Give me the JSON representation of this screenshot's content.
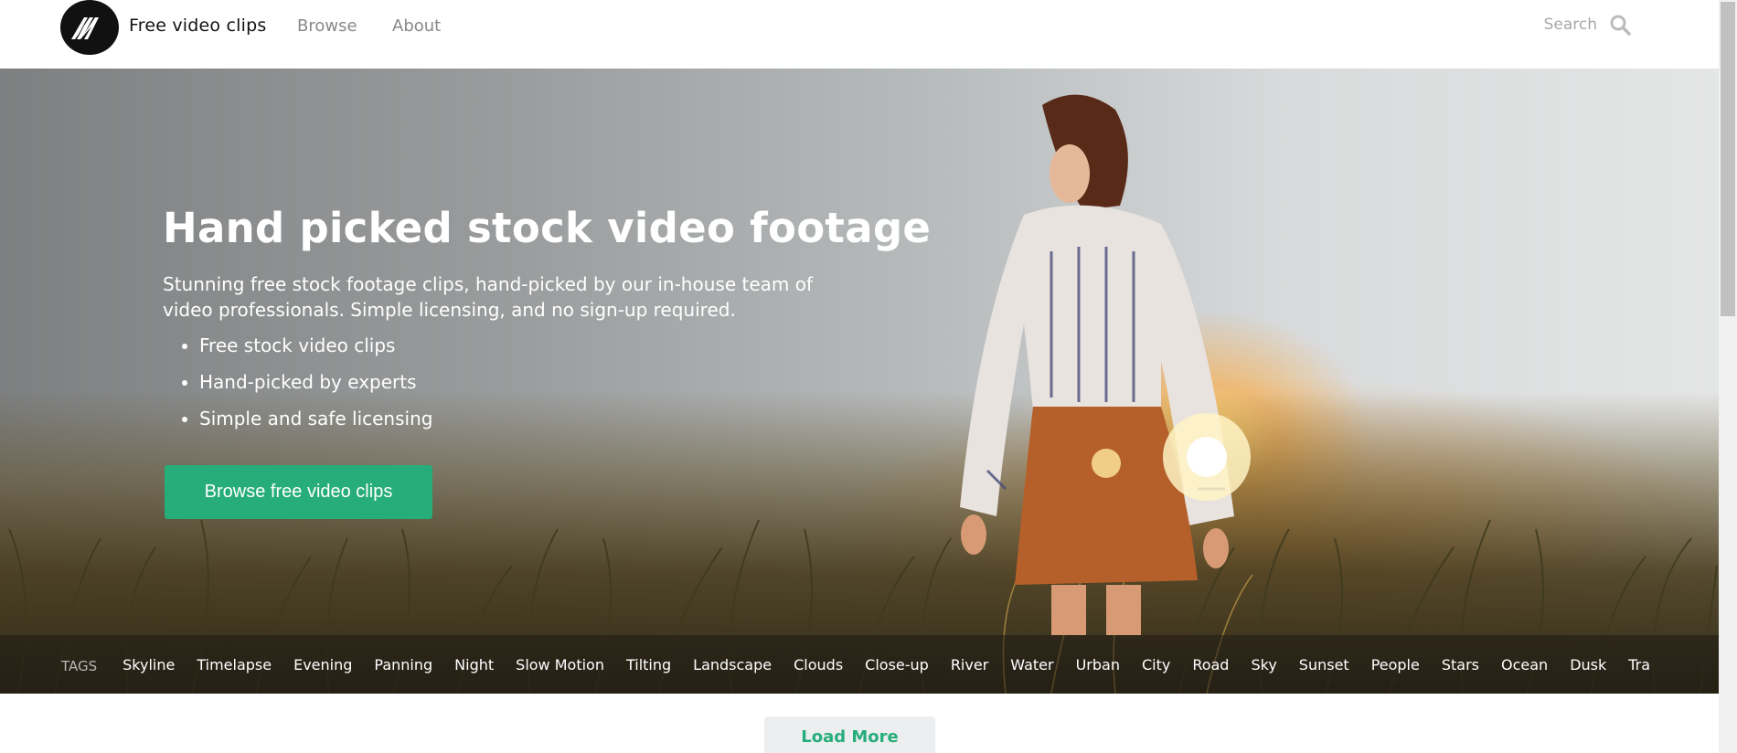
{
  "header": {
    "brand": "Free video clips",
    "nav": {
      "browse": "Browse",
      "about": "About"
    },
    "search": {
      "placeholder": "Search",
      "icon": "search-icon"
    },
    "logo_icon": "mixkit-logo-icon"
  },
  "hero": {
    "title": "Hand picked stock video footage",
    "description": "Stunning free stock footage clips, hand-picked by our in-house team of video professionals. Simple licensing, and no sign-up required.",
    "features": [
      "Free stock video clips",
      "Hand-picked by experts",
      "Simple and safe licensing"
    ],
    "cta_label": "Browse free video clips"
  },
  "tags": {
    "label": "TAGS",
    "items": [
      "Skyline",
      "Timelapse",
      "Evening",
      "Panning",
      "Night",
      "Slow Motion",
      "Tilting",
      "Landscape",
      "Clouds",
      "Close-up",
      "River",
      "Water",
      "Urban",
      "City",
      "Road",
      "Sky",
      "Sunset",
      "People",
      "Stars",
      "Ocean",
      "Dusk",
      "Tra"
    ]
  },
  "load_more_label": "Load More",
  "colors": {
    "accent": "#26ad7a",
    "header_bg": "#ffffff",
    "nav_text": "#888888",
    "load_more_bg": "#eceef0"
  }
}
